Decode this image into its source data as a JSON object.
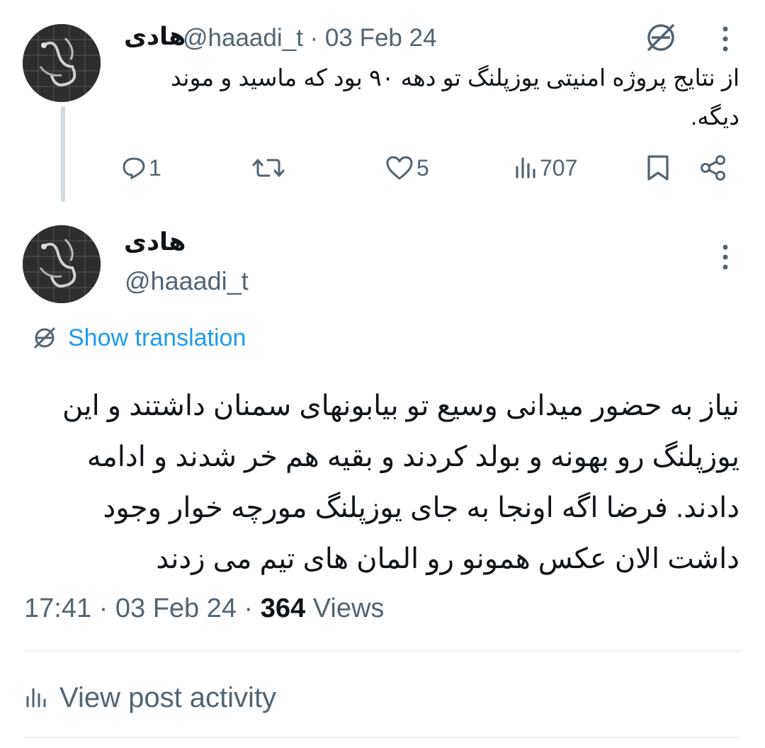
{
  "tweet1": {
    "name": "هادی",
    "handle_date": "@haaadi_t · 03 Feb 24",
    "text": "از نتایج پروژه امنیتی یوزپلنگ تو دهه ۹۰ بود که ماسید و موند دیگه.",
    "replies": "1",
    "retweets": "",
    "likes": "5",
    "views": "707"
  },
  "tweet2": {
    "name": "هادی",
    "handle": "@haaadi_t",
    "show_translation": "Show translation",
    "text": "نیاز به حضور میدانی وسیع تو بیابونهای سمنان داشتند و این یوزپلنگ رو بهونه و بولد کردند و بقیه هم خر شدند و ادامه دادند. فرضا اگه اونجا به جای یوزپلنگ مورچه خوار وجود داشت الان عکس همونو رو المان های تیم می زدند",
    "time_date": "17:41 · 03 Feb 24 · ",
    "views_count": "364",
    "views_label": " Views"
  },
  "activity": {
    "label": "View post activity"
  },
  "colors": {
    "text": "#0f1419",
    "secondary": "#536471",
    "link": "#1d9bf0",
    "divider": "#eff3f4"
  },
  "icons": [
    "translate-icon",
    "more-icon",
    "reply-icon",
    "retweet-icon",
    "like-icon",
    "views-icon",
    "bookmark-icon",
    "share-icon",
    "analytics-icon"
  ]
}
